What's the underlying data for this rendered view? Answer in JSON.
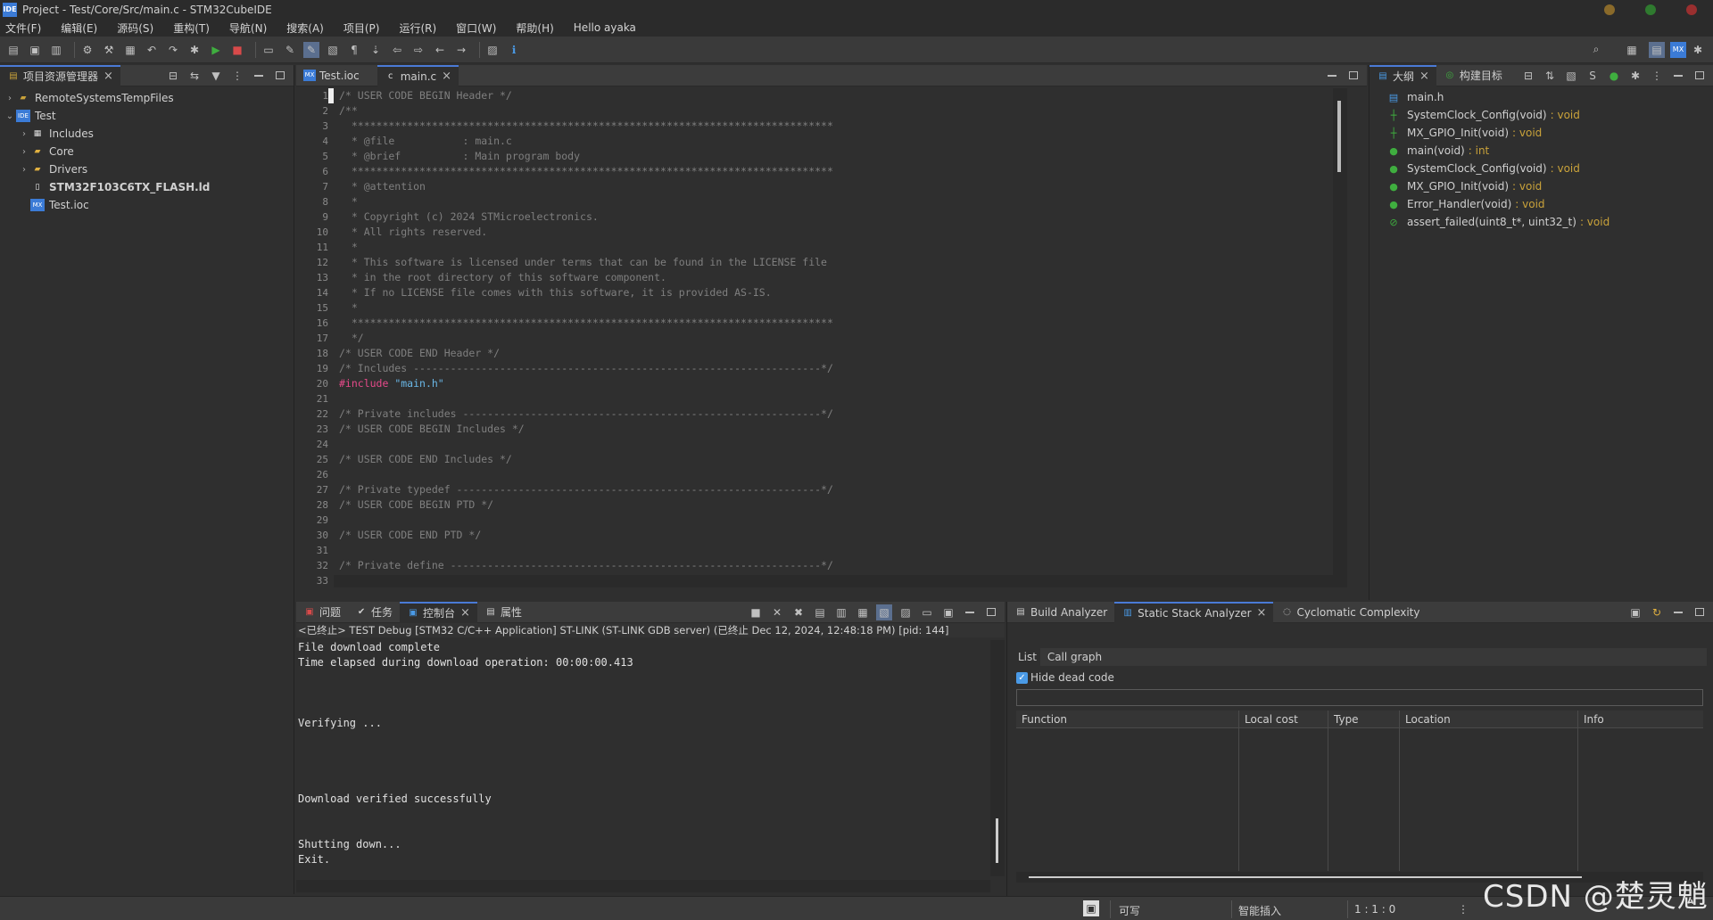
{
  "window": {
    "title": "Project - Test/Core/Src/main.c - STM32CubeIDE",
    "icon_text": "IDE"
  },
  "menu": [
    "文件(F)",
    "编辑(E)",
    "源码(S)",
    "重构(T)",
    "导航(N)",
    "搜索(A)",
    "项目(P)",
    "运行(R)",
    "窗口(W)",
    "帮助(H)",
    "Hello ayaka"
  ],
  "explorer": {
    "tab_label": "项目资源管理器",
    "items": [
      {
        "label": "RemoteSystemsTempFiles",
        "level": 0,
        "twisty": "›",
        "icon": "folder-icon"
      },
      {
        "label": "Test",
        "level": 0,
        "twisty": "⌄",
        "icon": "ide-project-icon"
      },
      {
        "label": "Includes",
        "level": 1,
        "twisty": "›",
        "icon": "includes-icon"
      },
      {
        "label": "Core",
        "level": 1,
        "twisty": "›",
        "icon": "folder-icon"
      },
      {
        "label": "Drivers",
        "level": 1,
        "twisty": "›",
        "icon": "folder-icon"
      },
      {
        "label": "STM32F103C6TX_FLASH.ld",
        "level": 1,
        "twisty": "",
        "icon": "file-icon"
      },
      {
        "label": "Test.ioc",
        "level": 1,
        "twisty": "",
        "icon": "mx-icon"
      }
    ]
  },
  "editor": {
    "tabs": [
      {
        "label": "Test.ioc",
        "icon_text": "MX",
        "active": false
      },
      {
        "label": "main.c",
        "icon_text": "c",
        "active": true
      }
    ],
    "lines": [
      {
        "n": "1",
        "text": "/* USER CODE BEGIN Header */"
      },
      {
        "n": "2",
        "text": "/**"
      },
      {
        "n": "3",
        "text": "  ******************************************************************************"
      },
      {
        "n": "4",
        "text": "  * @file           : main.c"
      },
      {
        "n": "5",
        "text": "  * @brief          : Main program body"
      },
      {
        "n": "6",
        "text": "  ******************************************************************************"
      },
      {
        "n": "7",
        "text": "  * @attention"
      },
      {
        "n": "8",
        "text": "  *"
      },
      {
        "n": "9",
        "text": "  * Copyright (c) 2024 STMicroelectronics."
      },
      {
        "n": "10",
        "text": "  * All rights reserved."
      },
      {
        "n": "11",
        "text": "  *"
      },
      {
        "n": "12",
        "text": "  * This software is licensed under terms that can be found in the LICENSE file"
      },
      {
        "n": "13",
        "text": "  * in the root directory of this software component."
      },
      {
        "n": "14",
        "text": "  * If no LICENSE file comes with this software, it is provided AS-IS."
      },
      {
        "n": "15",
        "text": "  *"
      },
      {
        "n": "16",
        "text": "  ******************************************************************************"
      },
      {
        "n": "17",
        "text": "  */"
      },
      {
        "n": "18",
        "text": "/* USER CODE END Header */"
      },
      {
        "n": "19",
        "text": "/* Includes ------------------------------------------------------------------*/"
      },
      {
        "n": "20",
        "text": "",
        "kw": "#include",
        "str": "\"main.h\""
      },
      {
        "n": "21",
        "text": ""
      },
      {
        "n": "22",
        "text": "/* Private includes ----------------------------------------------------------*/"
      },
      {
        "n": "23",
        "text": "/* USER CODE BEGIN Includes */"
      },
      {
        "n": "24",
        "text": ""
      },
      {
        "n": "25",
        "text": "/* USER CODE END Includes */"
      },
      {
        "n": "26",
        "text": ""
      },
      {
        "n": "27",
        "text": "/* Private typedef -----------------------------------------------------------*/"
      },
      {
        "n": "28",
        "text": "/* USER CODE BEGIN PTD */"
      },
      {
        "n": "29",
        "text": ""
      },
      {
        "n": "30",
        "text": "/* USER CODE END PTD */"
      },
      {
        "n": "31",
        "text": ""
      },
      {
        "n": "32",
        "text": "/* Private define ------------------------------------------------------------*/"
      },
      {
        "n": "33",
        "text": "/* USER CODE BEGIN PD */"
      }
    ]
  },
  "outline": {
    "tabs": [
      {
        "label": "大纲",
        "active": true
      },
      {
        "label": "构建目标",
        "active": false
      }
    ],
    "items": [
      {
        "name": "main.h",
        "ret": ""
      },
      {
        "name": "SystemClock_Config(void)",
        "ret": ": void"
      },
      {
        "name": "MX_GPIO_Init(void)",
        "ret": ": void"
      },
      {
        "name": "main(void)",
        "ret": ": int"
      },
      {
        "name": "SystemClock_Config(void)",
        "ret": ": void"
      },
      {
        "name": "MX_GPIO_Init(void)",
        "ret": ": void"
      },
      {
        "name": "Error_Handler(void)",
        "ret": ": void"
      },
      {
        "name": "assert_failed(uint8_t*, uint32_t)",
        "ret": ": void"
      }
    ]
  },
  "console": {
    "tabs": [
      {
        "label": "问题",
        "active": false
      },
      {
        "label": "任务",
        "active": false
      },
      {
        "label": "控制台",
        "active": true
      },
      {
        "label": "属性",
        "active": false
      }
    ],
    "header": "<已终止> TEST Debug [STM32 C/C++ Application] ST-LINK (ST-LINK GDB server) (已终止 Dec 12, 2024, 12:48:18 PM) [pid: 144]",
    "lines": [
      "File download complete",
      "Time elapsed during download operation: 00:00:00.413",
      "",
      "",
      "",
      "Verifying ...",
      "",
      "",
      "",
      "",
      "Download verified successfully",
      "",
      "",
      "Shutting down...",
      "Exit."
    ]
  },
  "analyzer": {
    "tabs": [
      {
        "label": "Build Analyzer",
        "active": false
      },
      {
        "label": "Static Stack Analyzer",
        "active": true
      },
      {
        "label": "Cyclomatic Complexity",
        "active": false
      }
    ],
    "subtabs": [
      "List",
      "Call graph"
    ],
    "hide_dead_code_label": "Hide dead code",
    "hide_dead_code_checked": true,
    "filter_value": "",
    "columns": [
      "Function",
      "Local cost",
      "Type",
      "Location",
      "Info"
    ]
  },
  "status": {
    "writable": "可写",
    "insert_mode": "智能插入",
    "position": "1 : 1 : 0"
  },
  "watermark": "CSDN @楚灵魈",
  "colors": {
    "accent": "#4a7ad6",
    "keyword": "#e64a8a",
    "string": "#6ab8e8",
    "return_type": "#c9a23a"
  }
}
